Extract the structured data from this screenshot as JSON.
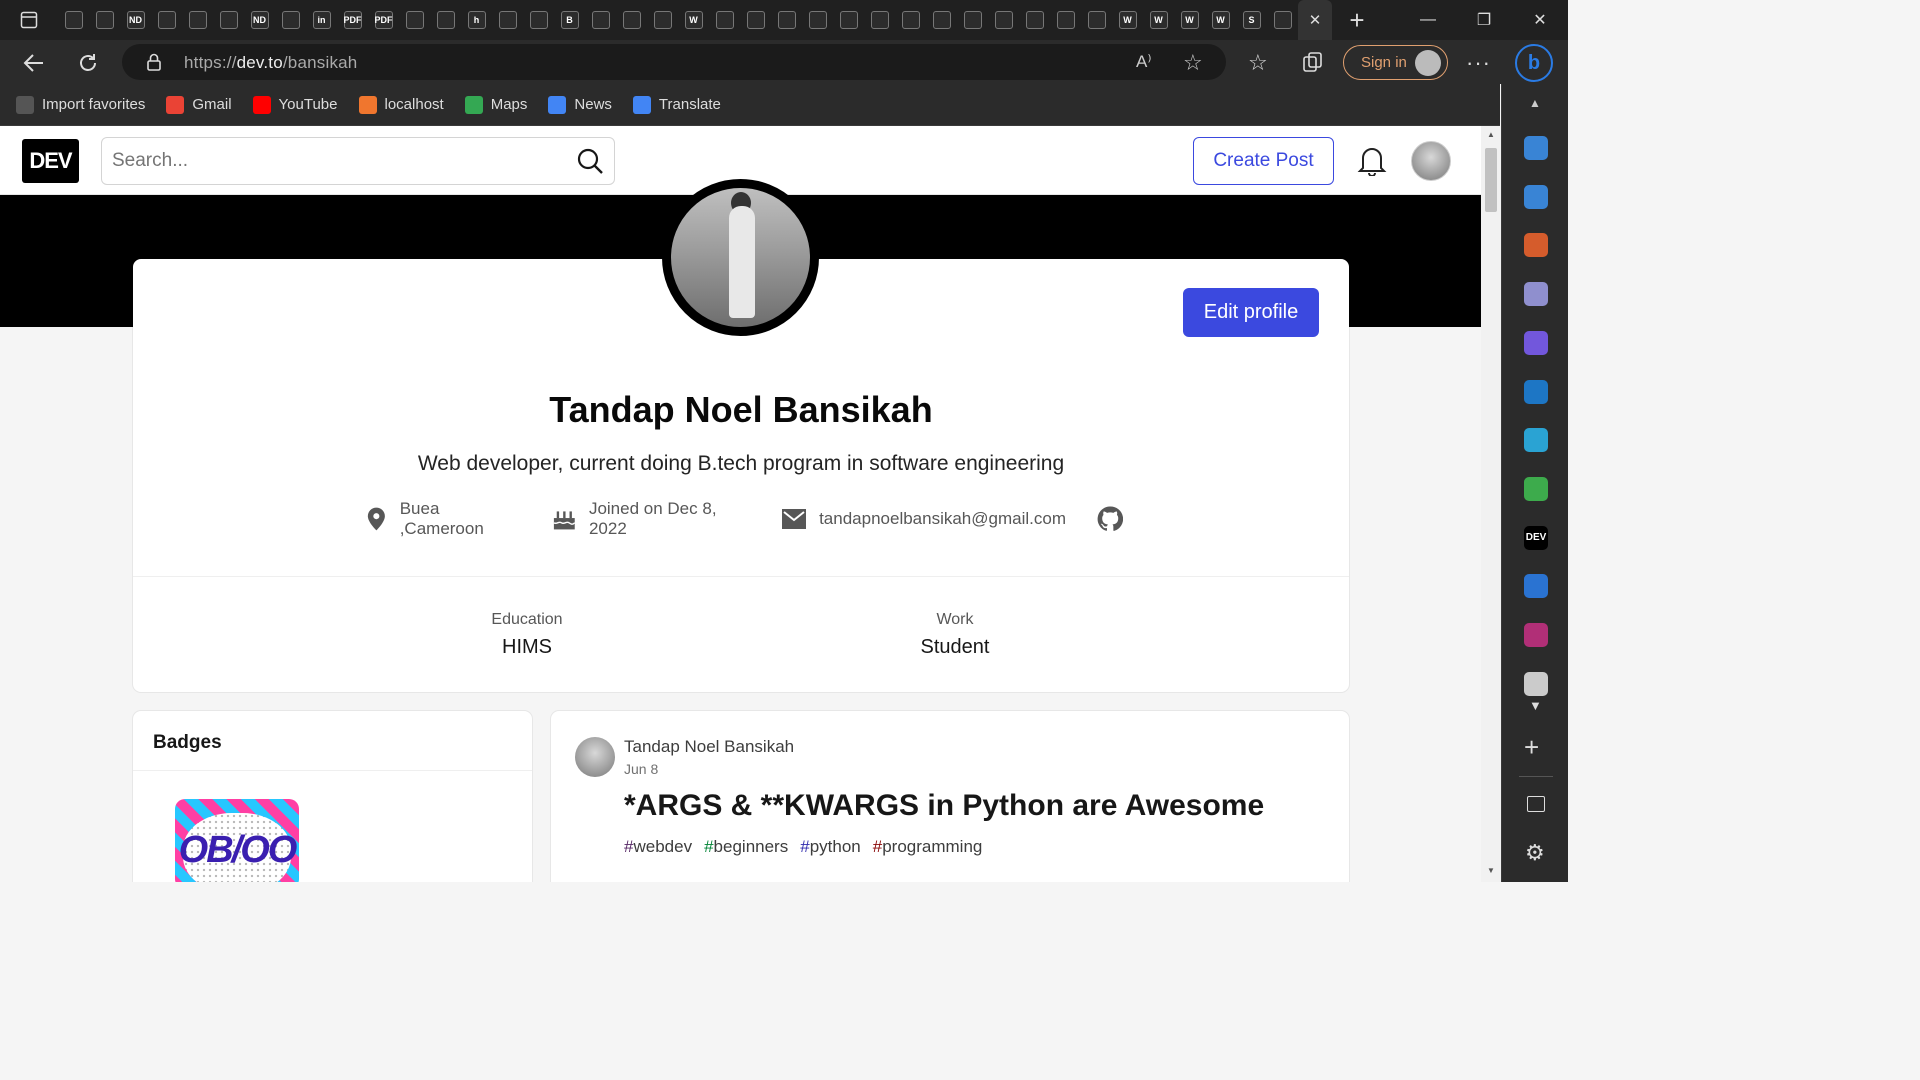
{
  "browser": {
    "url_prefix": "https://",
    "url_host": "dev.to",
    "url_path": "/bansikah",
    "signin_label": "Sign in",
    "tab_close": "✕",
    "new_tab": "+",
    "mini_tabs": [
      "",
      "",
      "ND",
      "",
      "",
      "",
      "ND",
      "",
      "in",
      "PDF",
      "PDF",
      "",
      "",
      "h",
      "",
      "",
      "B",
      "",
      "",
      "",
      "W",
      "",
      "",
      "",
      "",
      "",
      "",
      "",
      "",
      "",
      "",
      "",
      "",
      "",
      "W",
      "W",
      "W",
      "W",
      "S",
      ""
    ]
  },
  "bookmarks": [
    {
      "label": "Import favorites",
      "color": "#555555"
    },
    {
      "label": "Gmail",
      "color": "#ea4335"
    },
    {
      "label": "YouTube",
      "color": "#ff0000"
    },
    {
      "label": "localhost",
      "color": "#f0762e"
    },
    {
      "label": "Maps",
      "color": "#34a853"
    },
    {
      "label": "News",
      "color": "#4285f4"
    },
    {
      "label": "Translate",
      "color": "#4285f4"
    }
  ],
  "edge_sidebar_icons": [
    {
      "name": "search",
      "color": "#3b8ee8"
    },
    {
      "name": "shopping",
      "color": "#3b8ee8"
    },
    {
      "name": "tools",
      "color": "#e8622c"
    },
    {
      "name": "games",
      "color": "#9a9ae0"
    },
    {
      "name": "microsoft-365",
      "color": "#7a5cf0"
    },
    {
      "name": "outlook",
      "color": "#1c7ed6"
    },
    {
      "name": "send",
      "color": "#2ab0e6"
    },
    {
      "name": "tree",
      "color": "#3fb950"
    },
    {
      "name": "dev",
      "color": "#ffffff"
    },
    {
      "name": "bing",
      "color": "#2a7be4"
    },
    {
      "name": "app",
      "color": "#c03080"
    },
    {
      "name": "library",
      "color": "#dddddd"
    }
  ],
  "header": {
    "logo": "DEV",
    "search_placeholder": "Search...",
    "create_post_label": "Create Post"
  },
  "profile": {
    "edit_label": "Edit profile",
    "name": "Tandap Noel Bansikah",
    "bio": "Web developer, current doing B.tech program in software engineering",
    "location": "Buea ,Cameroon",
    "joined": "Joined on Dec 8, 2022",
    "email": "tandapnoelbansikah@gmail.com",
    "education_label": "Education",
    "education_value": "HIMS",
    "work_label": "Work",
    "work_value": "Student"
  },
  "badges": {
    "title": "Badges",
    "badge_text": "OB/OO"
  },
  "post": {
    "author": "Tandap Noel Bansikah",
    "date": "Jun 8",
    "title": "*ARGS & **KWARGS in Python are Awesome",
    "tags": [
      {
        "hash": "#",
        "name": "webdev",
        "color": "#562765"
      },
      {
        "hash": "#",
        "name": "beginners",
        "color": "#008335"
      },
      {
        "hash": "#",
        "name": "python",
        "color": "#2f2bad"
      },
      {
        "hash": "#",
        "name": "programming",
        "color": "#890606"
      }
    ]
  }
}
